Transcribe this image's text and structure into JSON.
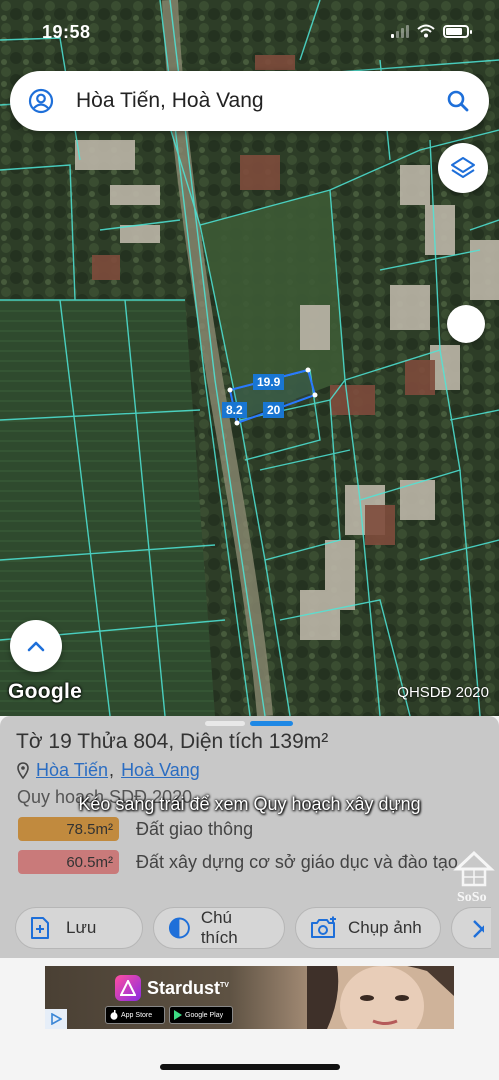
{
  "status_bar": {
    "time": "19:58"
  },
  "search": {
    "text": "Hòa Tiến, Hoà Vang"
  },
  "map": {
    "parcel_dims": [
      "19.9",
      "8.2",
      "20"
    ],
    "logo": "Google",
    "credit": "QHSDĐ 2020"
  },
  "sheet": {
    "title": "Tờ 19 Thửa 804, Diện tích 139m²",
    "location": {
      "commune": "Hòa Tiến",
      "separator": ",",
      "district": "Hoà Vang"
    },
    "plan_title": "Quy hoạch SDĐ 2020",
    "banner": "Kéo sang trái để xem Quy hoạch xây dựng",
    "land_uses": [
      {
        "area": "78.5m²",
        "label": "Đất giao thông",
        "color": "#c18a3e"
      },
      {
        "area": "60.5m²",
        "label": "Đất xây dựng cơ sở giáo dục và đào tạo",
        "color": "#c97a7a"
      }
    ],
    "actions": {
      "save": "Lưu",
      "legend": "Chú thích",
      "photo": "Chụp ảnh"
    },
    "watermark": "SoSo"
  },
  "ad": {
    "brand": "Stardust",
    "tm": "TV",
    "app_store": "App Store",
    "google_play": "Google Play"
  },
  "colors": {
    "accent": "#1e88e5",
    "link": "#2b6dc2",
    "parcel_line": "#4ee6d8"
  }
}
